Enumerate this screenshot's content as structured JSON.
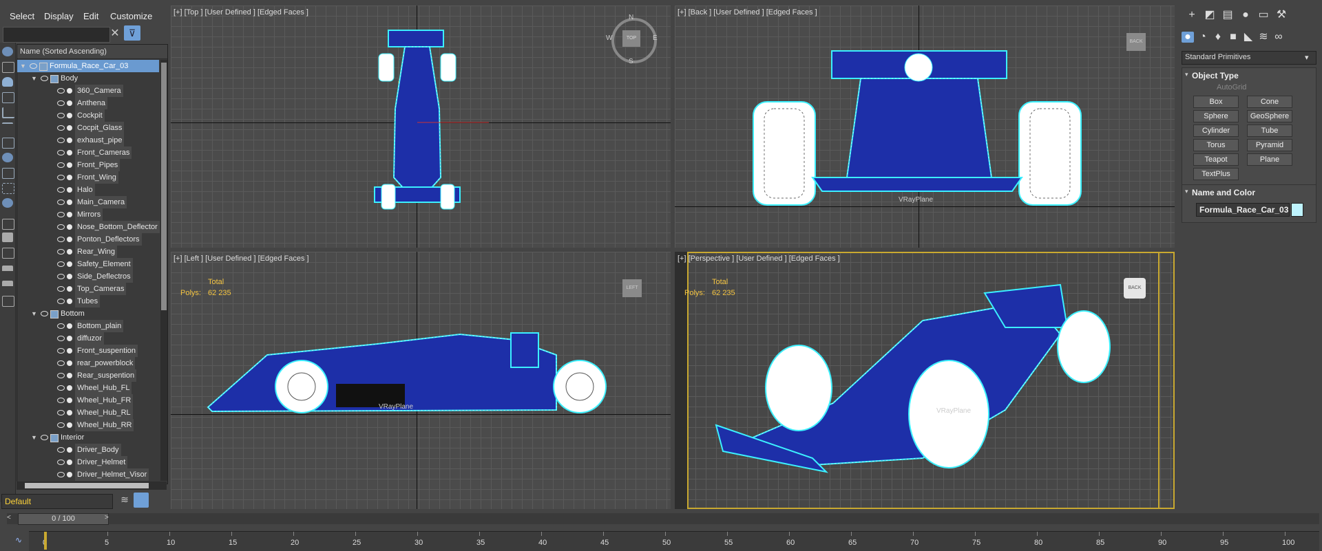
{
  "menu": [
    "Select",
    "Display",
    "Edit",
    "Customize"
  ],
  "explorer": {
    "column_header": "Name (Sorted Ascending)",
    "search_value": "",
    "rows": [
      {
        "label": "Formula_Race_Car_03",
        "depth": 0,
        "type": "root",
        "selected": true
      },
      {
        "label": "Body",
        "depth": 1,
        "type": "layer"
      },
      {
        "label": "360_Camera",
        "depth": 2,
        "type": "object"
      },
      {
        "label": "Anthena",
        "depth": 2,
        "type": "object"
      },
      {
        "label": "Cockpit",
        "depth": 2,
        "type": "object"
      },
      {
        "label": "Cocpit_Glass",
        "depth": 2,
        "type": "object"
      },
      {
        "label": "exhaust_pipe",
        "depth": 2,
        "type": "object"
      },
      {
        "label": "Front_Cameras",
        "depth": 2,
        "type": "object"
      },
      {
        "label": "Front_Pipes",
        "depth": 2,
        "type": "object"
      },
      {
        "label": "Front_Wing",
        "depth": 2,
        "type": "object"
      },
      {
        "label": "Halo",
        "depth": 2,
        "type": "object"
      },
      {
        "label": "Main_Camera",
        "depth": 2,
        "type": "object"
      },
      {
        "label": "Mirrors",
        "depth": 2,
        "type": "object"
      },
      {
        "label": "Nose_Bottom_Deflector",
        "depth": 2,
        "type": "object"
      },
      {
        "label": "Ponton_Deflectors",
        "depth": 2,
        "type": "object"
      },
      {
        "label": "Rear_Wing",
        "depth": 2,
        "type": "object"
      },
      {
        "label": "Safety_Element",
        "depth": 2,
        "type": "object"
      },
      {
        "label": "Side_Deflectros",
        "depth": 2,
        "type": "object"
      },
      {
        "label": "Top_Cameras",
        "depth": 2,
        "type": "object"
      },
      {
        "label": "Tubes",
        "depth": 2,
        "type": "object"
      },
      {
        "label": "Bottom",
        "depth": 1,
        "type": "layer"
      },
      {
        "label": "Bottom_plain",
        "depth": 2,
        "type": "object"
      },
      {
        "label": "diffuzor",
        "depth": 2,
        "type": "object"
      },
      {
        "label": "Front_suspention",
        "depth": 2,
        "type": "object"
      },
      {
        "label": "rear_powerblock",
        "depth": 2,
        "type": "object"
      },
      {
        "label": "Rear_suspention",
        "depth": 2,
        "type": "object"
      },
      {
        "label": "Wheel_Hub_FL",
        "depth": 2,
        "type": "object"
      },
      {
        "label": "Wheel_Hub_FR",
        "depth": 2,
        "type": "object"
      },
      {
        "label": "Wheel_Hub_RL",
        "depth": 2,
        "type": "object"
      },
      {
        "label": "Wheel_Hub_RR",
        "depth": 2,
        "type": "object"
      },
      {
        "label": "Interior",
        "depth": 1,
        "type": "layer"
      },
      {
        "label": "Driver_Body",
        "depth": 2,
        "type": "object"
      },
      {
        "label": "Driver_Helmet",
        "depth": 2,
        "type": "object"
      },
      {
        "label": "Driver_Helmet_Visor",
        "depth": 2,
        "type": "object"
      }
    ]
  },
  "layer_dropdown": "Default",
  "viewports": {
    "top": {
      "label": "[+] [Top ] [User Defined ] [Edged Faces ]",
      "compass": {
        "n": "N",
        "e": "E",
        "s": "S",
        "w": "W",
        "cube": "TOP"
      }
    },
    "back": {
      "label": "[+] [Back ] [User Defined ] [Edged Faces ]",
      "cube": "BACK",
      "plane": "VRayPlane"
    },
    "left": {
      "label": "[+] [Left ] [User Defined ] [Edged Faces ]",
      "cube": "LEFT",
      "plane": "VRayPlane",
      "stats": {
        "title": "Total",
        "polys_label": "Polys:",
        "polys": "62 235"
      }
    },
    "persp": {
      "label": "[+] [Perspective ] [User Defined ] [Edged Faces ]",
      "cube": "BACK",
      "plane": "VRayPlane",
      "stats": {
        "title": "Total",
        "polys_label": "Polys:",
        "polys": "62 235"
      }
    }
  },
  "command_panel": {
    "category": "Standard Primitives",
    "object_type_title": "Object Type",
    "autogrid": "AutoGrid",
    "buttons": [
      "Box",
      "Cone",
      "Sphere",
      "GeoSphere",
      "Cylinder",
      "Tube",
      "Torus",
      "Pyramid",
      "Teapot",
      "Plane",
      "TextPlus"
    ],
    "name_color_title": "Name and Color",
    "object_name": "Formula_Race_Car_03",
    "swatch_color": "#bff4ff"
  },
  "timeline": {
    "frame": "0 / 100",
    "ticks": [
      "0",
      "5",
      "10",
      "15",
      "20",
      "25",
      "30",
      "35",
      "40",
      "45",
      "50",
      "55",
      "60",
      "65",
      "70",
      "75",
      "80",
      "85",
      "90",
      "95",
      "100"
    ]
  },
  "colors": {
    "wire": "#ffffff",
    "select": "#3cf0ff",
    "body": "#1d2fa8",
    "active_vp": "#c9a930"
  }
}
